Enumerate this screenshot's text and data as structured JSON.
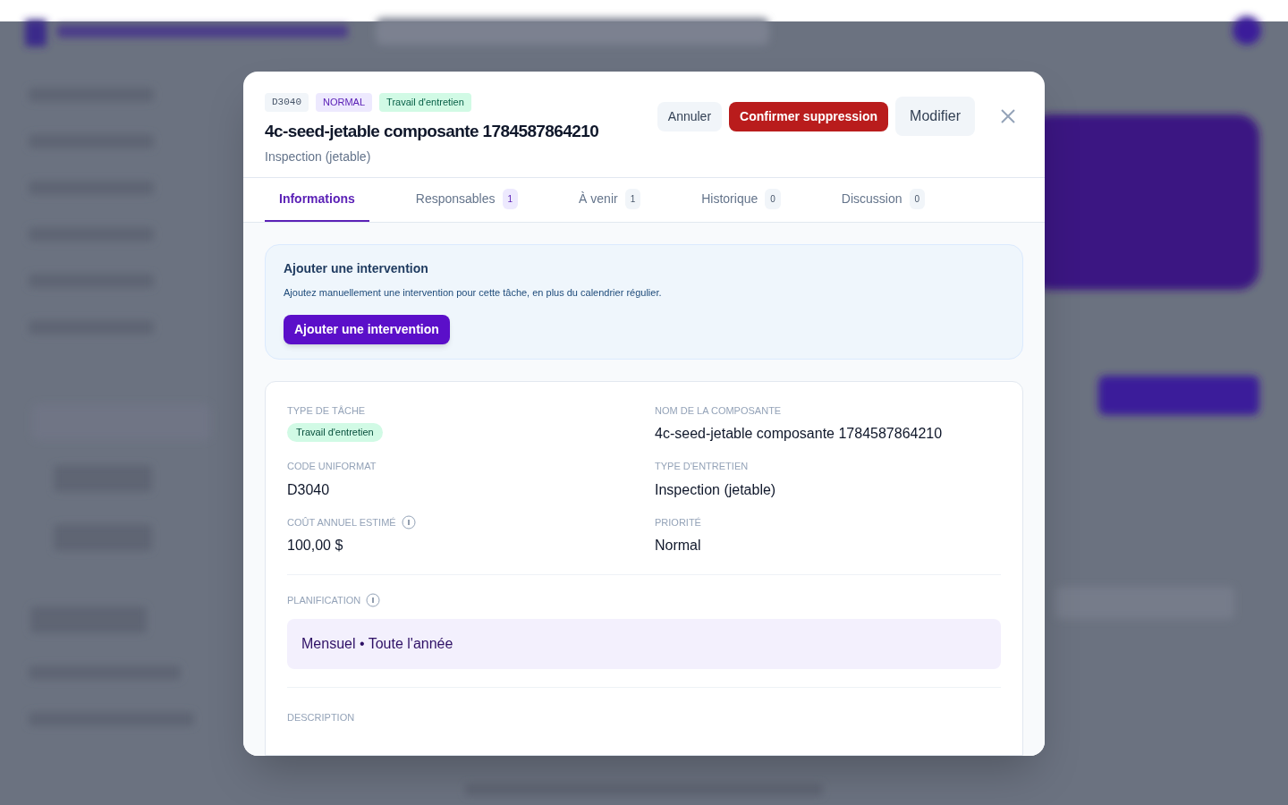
{
  "dialog": {
    "badges": [
      {
        "label": "D3040",
        "kind": "code"
      },
      {
        "label": "NORMAL",
        "kind": "priority"
      },
      {
        "label": "Travail d'entretien",
        "kind": "type"
      }
    ],
    "title": "4c-seed-jetable composante 1784587864210",
    "subtitle": "Inspection (jetable)",
    "actions": [
      {
        "label": "Annuler",
        "kind": "secondary"
      },
      {
        "label": "Confirmer suppression",
        "kind": "danger"
      },
      {
        "label": "Modifier",
        "kind": "large"
      }
    ],
    "tabs": [
      {
        "label": "Informations",
        "selected": true
      },
      {
        "label": "Responsables",
        "count": "1",
        "selected": false
      },
      {
        "label": "À venir",
        "count": "1",
        "selected": false
      },
      {
        "label": "Historique",
        "count": "0",
        "selected": false
      },
      {
        "label": "Discussion",
        "count": "0",
        "selected": false
      }
    ],
    "add_intervention": {
      "title": "Ajouter une intervention",
      "text": "Ajoutez manuellement une intervention pour cette tâche, en plus du calendrier régulier.",
      "button": "Ajouter une intervention"
    },
    "fields": [
      {
        "label": "TYPE DE TÂCHE",
        "value": "Travail d'entretien",
        "kind": "tag"
      },
      {
        "label": "NOM DE LA COMPOSANTE",
        "value": "4c-seed-jetable composante 1784587864210",
        "kind": "text"
      },
      {
        "label": "CODE UNIFORMAT",
        "value": "D3040",
        "kind": "text"
      },
      {
        "label": "TYPE D'ENTRETIEN",
        "value": "Inspection (jetable)",
        "kind": "text"
      },
      {
        "label": "COÛT ANNUEL ESTIMÉ",
        "value": "100,00 $",
        "kind": "text",
        "info": true
      },
      {
        "label": "PRIORITÉ",
        "value": "Normal",
        "kind": "text"
      }
    ],
    "planning": {
      "label": "PLANIFICATION",
      "value": "Mensuel • Toute l'année"
    },
    "description": {
      "label": "DESCRIPTION"
    }
  }
}
